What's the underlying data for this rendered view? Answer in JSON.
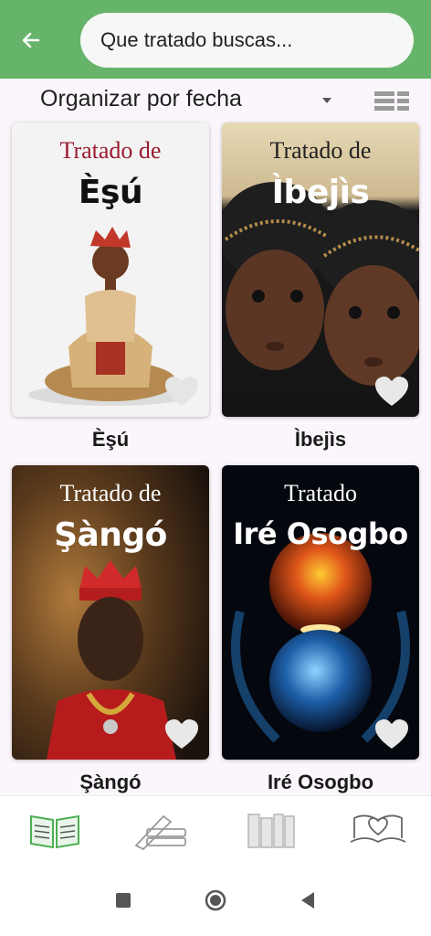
{
  "search": {
    "placeholder": "Que tratado buscas..."
  },
  "sort": {
    "label": "Organizar por fecha"
  },
  "cards": [
    {
      "caption_top": "Tratado de",
      "caption_title": "Èşú",
      "label": "Èşú",
      "caption_color": "#9b1b30",
      "title_color": "#111111"
    },
    {
      "caption_top": "Tratado de",
      "caption_title": "Ìbejìs",
      "label": "Ìbejìs",
      "caption_color": "#222222",
      "title_color": "#ffffff"
    },
    {
      "caption_top": "Tratado de",
      "caption_title": "Şàngó",
      "label": "Şàngó",
      "caption_color": "#ffffff",
      "title_color": "#ffffff"
    },
    {
      "caption_top": "Tratado",
      "caption_title": "Iré Osogbo",
      "label": "Iré Osogbo",
      "caption_color": "#ffffff",
      "title_color": "#ffffff"
    }
  ],
  "nav": [
    "open-book-icon",
    "books-stack-icon",
    "bookshelf-icon",
    "book-heart-icon"
  ],
  "colors": {
    "header": "#66b36a",
    "background": "#fbf6fc",
    "accent": "#4caf50"
  }
}
